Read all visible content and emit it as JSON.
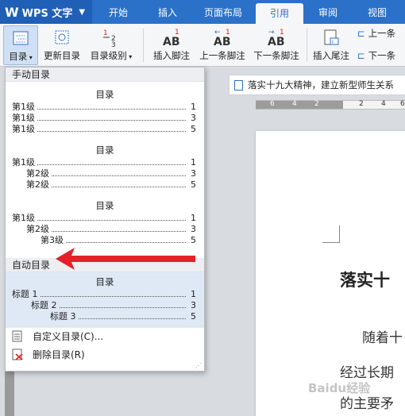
{
  "app": {
    "name": "WPS 文字"
  },
  "tabs": [
    "开始",
    "插入",
    "页面布局",
    "引用",
    "审阅",
    "视图"
  ],
  "ribbon": {
    "toc": "目录",
    "update_toc": "更新目录",
    "toc_level": "目录级别",
    "insert_footnote": "插入脚注",
    "prev_footnote": "上一条脚注",
    "next_footnote": "下一条脚注",
    "insert_endnote": "插入尾注",
    "prev_small": "上一条",
    "next_small": "下一条"
  },
  "document": {
    "tab_title": "落实十九大精神，建立新型师生关系",
    "ruler": [
      "6",
      "4",
      "2",
      "2",
      "4",
      "6"
    ],
    "heading": "落实十",
    "line1": "随着十",
    "line2": "经过长期",
    "line3": "的主要矛",
    "watermark": "Baidu经验"
  },
  "dropdown": {
    "manual_header": "手动目录",
    "auto_header": "自动目录",
    "block1": {
      "title": "目录",
      "rows": [
        {
          "label": "第1级",
          "num": "1"
        },
        {
          "label": "第1级",
          "num": "3"
        },
        {
          "label": "第1级",
          "num": "5"
        }
      ]
    },
    "block2": {
      "title": "目录",
      "rows": [
        {
          "label": "第1级",
          "num": "1"
        },
        {
          "label": "第2级",
          "num": "3"
        },
        {
          "label": "第2级",
          "num": "5"
        }
      ]
    },
    "block3": {
      "title": "目录",
      "rows": [
        {
          "label": "第1级",
          "num": "1"
        },
        {
          "label": "第2级",
          "num": "3"
        },
        {
          "label": "第3级",
          "num": "5"
        }
      ]
    },
    "auto": {
      "title": "目录",
      "rows": [
        {
          "label": "标题 1",
          "num": "1"
        },
        {
          "label": "标题 2",
          "num": "3"
        },
        {
          "label": "标题 3",
          "num": "5"
        }
      ]
    },
    "custom_toc": "自定义目录(C)...",
    "delete_toc": "删除目录(R)"
  },
  "colors": {
    "brand": "#2b71c9",
    "arrow": "#e0222a",
    "auto_bg": "#dfe9f6"
  }
}
